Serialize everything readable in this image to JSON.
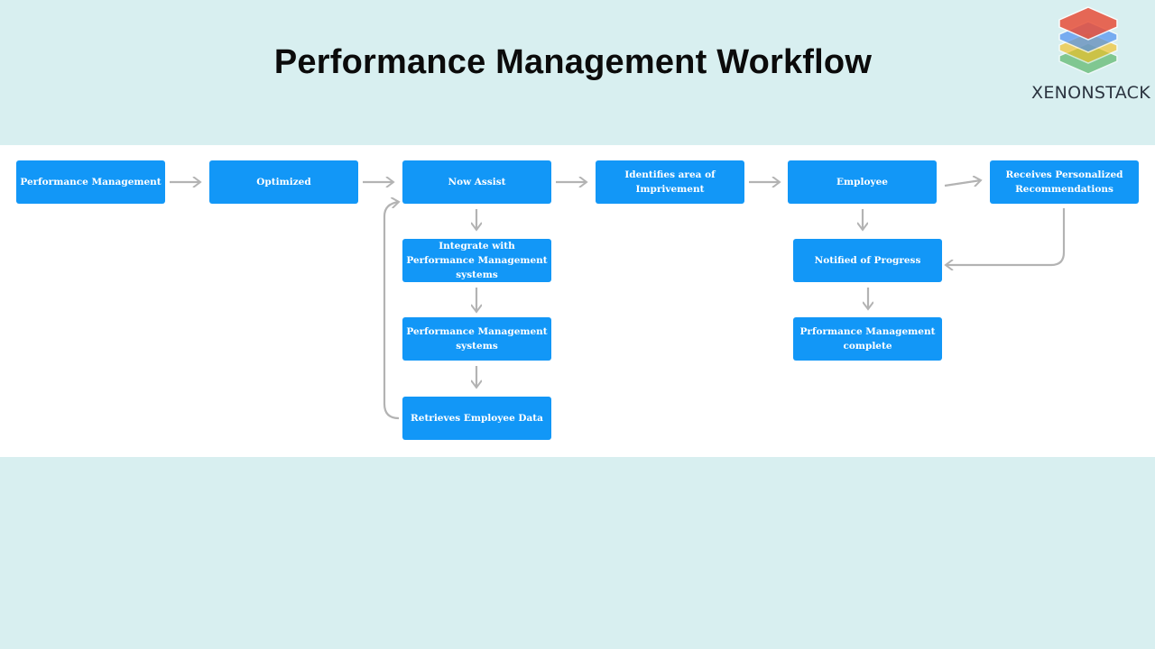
{
  "header": {
    "title": "Performance Management Workflow",
    "logo_text": "XENONSTACK",
    "logo_layer_colors": [
      "#e8503a",
      "#4f90f0",
      "#f4c020",
      "#3aa844"
    ]
  },
  "colors": {
    "background": "#d8eff0",
    "panel": "#ffffff",
    "node_fill": "#1297f7",
    "node_text": "#ffffff",
    "connector": "#b3b3b3"
  },
  "nodes": [
    {
      "id": "performance-management",
      "label": "Performance Management"
    },
    {
      "id": "optimized",
      "label": "Optimized"
    },
    {
      "id": "now-assist",
      "label": "Now Assist"
    },
    {
      "id": "identifies-area",
      "label": "Identifies area of Imprivement"
    },
    {
      "id": "employee",
      "label": "Employee"
    },
    {
      "id": "receives-recommendations",
      "label": "Receives Personalized Recommendations"
    },
    {
      "id": "integrate-systems",
      "label": "Integrate with Performance Management systems"
    },
    {
      "id": "pm-systems",
      "label": "Performance Management systems"
    },
    {
      "id": "retrieves-data",
      "label": "Retrieves Employee Data"
    },
    {
      "id": "notified-progress",
      "label": "Notified of Progress"
    },
    {
      "id": "pm-complete",
      "label": "Prformance Management complete"
    }
  ],
  "edges": [
    {
      "from": "performance-management",
      "to": "optimized"
    },
    {
      "from": "optimized",
      "to": "now-assist"
    },
    {
      "from": "now-assist",
      "to": "identifies-area"
    },
    {
      "from": "identifies-area",
      "to": "employee"
    },
    {
      "from": "employee",
      "to": "receives-recommendations"
    },
    {
      "from": "now-assist",
      "to": "integrate-systems"
    },
    {
      "from": "integrate-systems",
      "to": "pm-systems"
    },
    {
      "from": "pm-systems",
      "to": "retrieves-data"
    },
    {
      "from": "retrieves-data",
      "to": "now-assist"
    },
    {
      "from": "employee",
      "to": "notified-progress"
    },
    {
      "from": "receives-recommendations",
      "to": "notified-progress"
    },
    {
      "from": "notified-progress",
      "to": "pm-complete"
    }
  ]
}
